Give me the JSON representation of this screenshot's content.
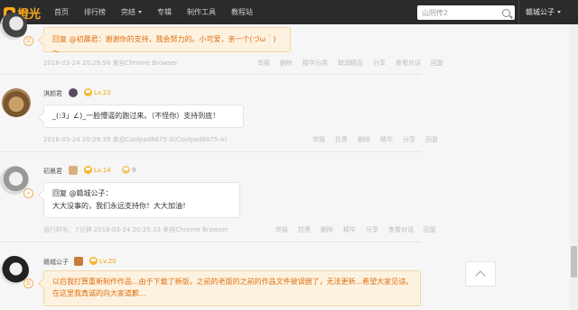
{
  "topbar": {
    "logo_text": "橙光",
    "nav": [
      "首页",
      "排行榜",
      "完结",
      "专辑",
      "制作工具",
      "教程站"
    ],
    "search_value": "山阴传2",
    "user_name": "赣城公子"
  },
  "comments": [
    {
      "text": "回复 @初晨君：谢谢你的支持，我会努力的。小可爱，亲一个(づω｀)～",
      "meta": "2018-03-24 20:29:56    来自Chrome Browser",
      "actions": [
        "举报",
        "删除",
        "精华分类",
        "取消精品",
        "分享",
        "查看对话",
        "回复"
      ]
    },
    {
      "name": "淇颜君",
      "level": "Lv.23",
      "text": "_(:3」∠)_一脸懵逼的跑过来。（不怪你）支持到底！",
      "meta": "2018-03-24 20:29:39    来自Coolpad8675-A(Coolpad8675-A)",
      "actions": [
        "举报",
        "拉黑",
        "删除",
        "精华",
        "分享",
        "回复"
      ]
    },
    {
      "name": "初晨君",
      "level": "Lv.14",
      "extra_count": "9",
      "text_line1": "回复 @赣城公子：",
      "text_line2": "大大没事的，我们永远支持你！大大加油！",
      "meta": "运行时长：7分钟    2018-03-24 20:25:33    来自Chrome Browser",
      "actions": [
        "举报",
        "拉黑",
        "删除",
        "精华",
        "分享",
        "查看对话",
        "回复"
      ]
    },
    {
      "name": "赣城公子",
      "level": "Lv.20",
      "text_line1": "以后我打算重新制作作品...由于下载了新版，之前的老版的之前的作品文件被误删了，无法更新...希望大家见谅。",
      "text_line2": "在这里我真诚的向大家道歉..."
    }
  ],
  "colors": {
    "accent": "#f7a71e",
    "topbar": "#2b2b2b",
    "reply_bg": "#fdf2e0"
  },
  "icons": [
    "logo-icon",
    "search-icon",
    "level-icon",
    "chevron-up-icon"
  ]
}
